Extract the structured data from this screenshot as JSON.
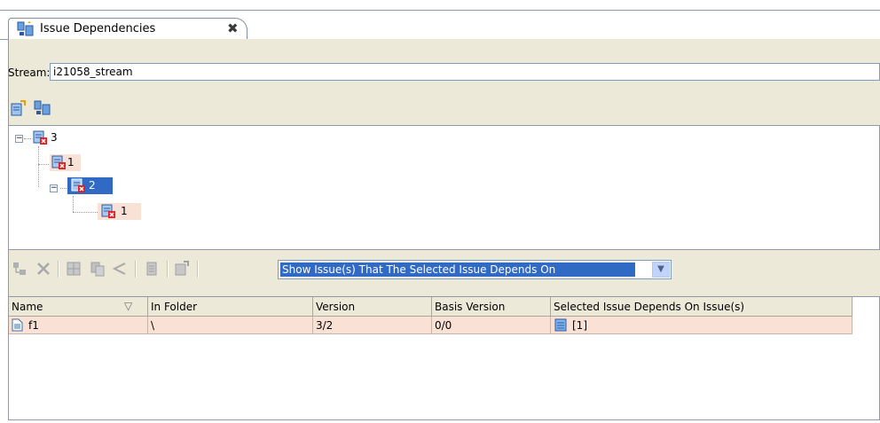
{
  "tab": {
    "title": "Issue Dependencies",
    "close_label": "✖"
  },
  "stream": {
    "label": "Stream:",
    "value": "i21058_stream"
  },
  "tree": {
    "nodes": [
      {
        "label": "3",
        "depth": 0,
        "expanded": true,
        "selected": false
      },
      {
        "label": "1",
        "depth": 1,
        "expanded": false,
        "selected": false
      },
      {
        "label": "2",
        "depth": 1,
        "expanded": true,
        "selected": true
      },
      {
        "label": "1",
        "depth": 2,
        "expanded": false,
        "selected": false
      }
    ]
  },
  "filter": {
    "selected": "Show Issue(s) That The Selected Issue Depends On",
    "arrow": "▼"
  },
  "table": {
    "sort_indicator": "▽",
    "columns": [
      "Name",
      "In Folder",
      "Version",
      "Basis Version",
      "Selected Issue Depends On Issue(s)"
    ],
    "rows": [
      {
        "name": "f1",
        "folder": "\\",
        "version": "3/2",
        "basis": "0/0",
        "depends": "[1]"
      }
    ]
  },
  "colors": {
    "tree_row_highlight": "#fae1d5",
    "selection": "#316ac5",
    "panel_bg": "#ece9d8"
  }
}
